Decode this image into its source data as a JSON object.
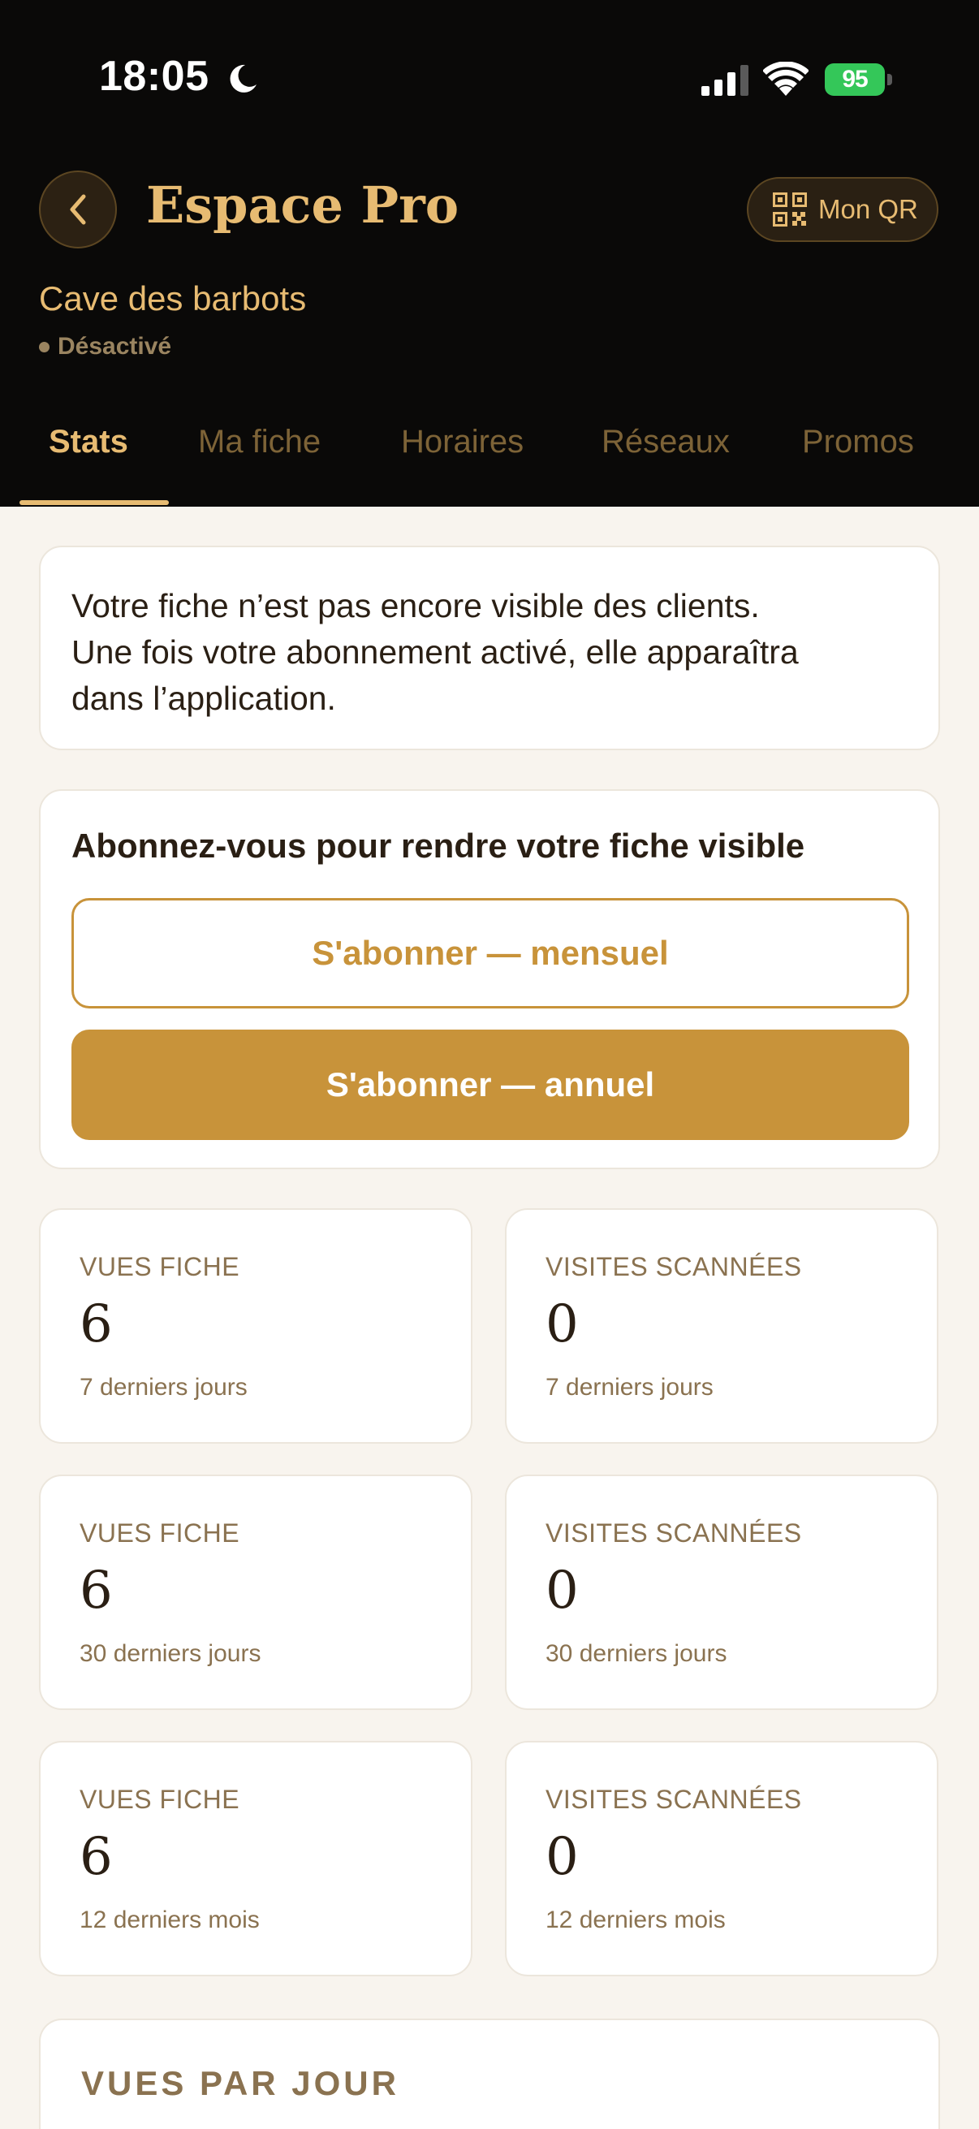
{
  "status_bar": {
    "time": "18:05",
    "battery_percent": "95"
  },
  "header": {
    "title": "Espace Pro",
    "qr_button_label": "Mon QR",
    "business_name": "Cave des barbots",
    "business_status": "Désactivé"
  },
  "tabs": [
    {
      "label": "Stats",
      "active": true
    },
    {
      "label": "Ma fiche",
      "active": false
    },
    {
      "label": "Horaires",
      "active": false
    },
    {
      "label": "Réseaux",
      "active": false
    },
    {
      "label": "Promos",
      "active": false
    }
  ],
  "notice": {
    "line1": "Votre fiche n’est pas encore visible des clients.",
    "line2": "Une fois votre abonnement activé, elle apparaîtra",
    "line3": "dans l’application."
  },
  "subscribe": {
    "title": "Abonnez-vous pour rendre votre fiche visible",
    "monthly_label": "S'abonner — mensuel",
    "annual_label": "S'abonner — annuel"
  },
  "stats": [
    {
      "label": "VUES FICHE",
      "value": "6",
      "period": "7 derniers jours"
    },
    {
      "label": "VISITES SCANNÉES",
      "value": "0",
      "period": "7 derniers jours"
    },
    {
      "label": "VUES FICHE",
      "value": "6",
      "period": "30 derniers jours"
    },
    {
      "label": "VISITES SCANNÉES",
      "value": "0",
      "period": "30 derniers jours"
    },
    {
      "label": "VUES FICHE",
      "value": "6",
      "period": "12 derniers mois"
    },
    {
      "label": "VISITES SCANNÉES",
      "value": "0",
      "period": "12 derniers mois"
    }
  ],
  "chart_section": {
    "title": "VUES PAR JOUR"
  },
  "colors": {
    "accent": "#c8933a",
    "header_gold": "#e7bb72",
    "header_bg": "#0a0908",
    "page_bg": "#f8f4ee",
    "battery": "#34c759"
  }
}
